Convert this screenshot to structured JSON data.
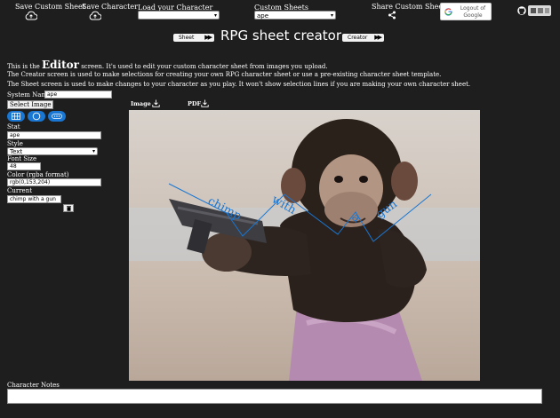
{
  "topbar": {
    "save_custom_sheet": "Save Custom Sheet",
    "save_character": "Save Character",
    "load_character_label": "Load your Character",
    "load_character_value": "",
    "custom_sheets_label": "Custom Sheets",
    "custom_sheets_value": "ape",
    "share_custom_sheet": "Share Custom Sheet",
    "logout_label": "Logout of Google"
  },
  "nav": {
    "sheet_button": "Sheet",
    "creator_button": "Creator",
    "title": "RPG sheet creator"
  },
  "info": {
    "line1_prefix": "This is the",
    "line1_big": "Editor",
    "line1_suffix": "screen. It's used to edit your custom character sheet from images you upload.",
    "line2": "The Creator screen is used to make selections for creating your own RPG character sheet or use a pre-existing character sheet template.",
    "line3": "The Sheet screen is used to make changes to your character as you play. It won't show selection lines if you are making your own character sheet."
  },
  "editor": {
    "system_name_label": "System Name",
    "system_name_value": "ape",
    "select_image_button": "Select Image",
    "stat_label": "Stat",
    "stat_value": "ape",
    "style_label": "Style",
    "style_value": "Text",
    "font_size_label": "Font Size",
    "font_size_value": "48",
    "color_label": "Color (rgba format)",
    "color_value": "rgb(0,153,204)",
    "current_label": "Current",
    "current_value": "chimp with a gun"
  },
  "downloads": {
    "image_label": "Image",
    "pdf_label": "PDF"
  },
  "canvas_text": {
    "w1": "chimp",
    "w2": "with",
    "w3": "a",
    "w4": "gun"
  },
  "notes": {
    "label": "Character Notes",
    "value": ""
  },
  "colors": {
    "background": "#1e1e1e",
    "accent": "#1976d2"
  }
}
